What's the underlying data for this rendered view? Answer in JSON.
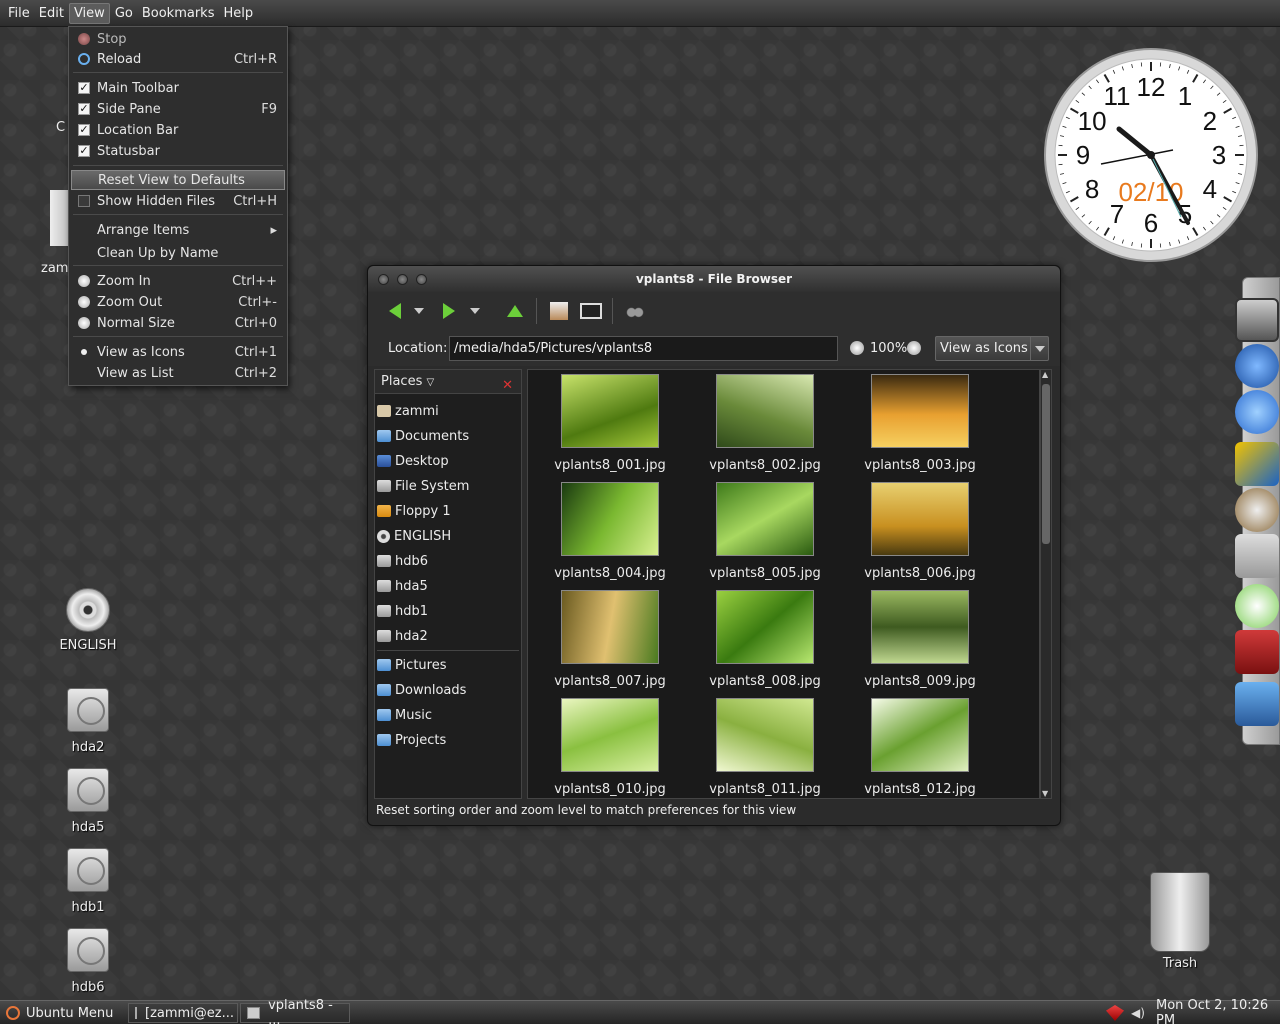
{
  "menubar": {
    "items": [
      "File",
      "Edit",
      "View",
      "Go",
      "Bookmarks",
      "Help"
    ]
  },
  "view_menu": {
    "items": [
      {
        "label": "Stop",
        "accel": "",
        "kind": "icon"
      },
      {
        "label": "Reload",
        "accel": "Ctrl+R",
        "kind": "icon"
      },
      {
        "label": "Main Toolbar",
        "accel": "",
        "kind": "check",
        "checked": true
      },
      {
        "label": "Side Pane",
        "accel": "F9",
        "kind": "check",
        "checked": true
      },
      {
        "label": "Location Bar",
        "accel": "",
        "kind": "check",
        "checked": true
      },
      {
        "label": "Statusbar",
        "accel": "",
        "kind": "check",
        "checked": true
      },
      {
        "label": "Reset View to Defaults",
        "accel": "",
        "kind": "plain",
        "highlighted": true
      },
      {
        "label": "Show Hidden Files",
        "accel": "Ctrl+H",
        "kind": "check",
        "checked": false
      },
      {
        "label": "Arrange Items",
        "accel": "▸",
        "kind": "plain"
      },
      {
        "label": "Clean Up by Name",
        "accel": "",
        "kind": "plain"
      },
      {
        "label": "Zoom In",
        "accel": "Ctrl++",
        "kind": "icon"
      },
      {
        "label": "Zoom Out",
        "accel": "Ctrl+-",
        "kind": "icon"
      },
      {
        "label": "Normal Size",
        "accel": "Ctrl+0",
        "kind": "icon"
      },
      {
        "label": "View as Icons",
        "accel": "Ctrl+1",
        "kind": "radio",
        "checked": true
      },
      {
        "label": "View as List",
        "accel": "Ctrl+2",
        "kind": "radio",
        "checked": false
      }
    ]
  },
  "desktop": {
    "icons": [
      {
        "label": "ENGLISH",
        "kind": "dvd"
      },
      {
        "label": "hda2",
        "kind": "drive"
      },
      {
        "label": "hda5",
        "kind": "drive"
      },
      {
        "label": "hdb1",
        "kind": "drive"
      },
      {
        "label": "hdb6",
        "kind": "drive"
      }
    ],
    "partial_labels": [
      "C",
      "zam"
    ],
    "trash_label": "Trash"
  },
  "clock": {
    "date_text": "02/10",
    "numerals": [
      "12",
      "1",
      "2",
      "3",
      "4",
      "5",
      "6",
      "7",
      "8",
      "9",
      "10",
      "11"
    ],
    "date_color": "#e87a1e"
  },
  "file_browser": {
    "title": "vplants8 - File Browser",
    "location_label": "Location:",
    "location_value": "/media/hda5/Pictures/vplants8",
    "zoom": "100%",
    "view_as": "View as Icons",
    "places_header": "Places",
    "places": [
      {
        "label": "zammi",
        "icon": "home"
      },
      {
        "label": "Documents",
        "icon": "folder"
      },
      {
        "label": "Desktop",
        "icon": "desk"
      },
      {
        "label": "File System",
        "icon": "drive"
      },
      {
        "label": "Floppy 1",
        "icon": "floppy"
      },
      {
        "label": "ENGLISH",
        "icon": "disc"
      },
      {
        "label": "hdb6",
        "icon": "drive"
      },
      {
        "label": "hda5",
        "icon": "drive"
      },
      {
        "label": "hdb1",
        "icon": "drive"
      },
      {
        "label": "hda2",
        "icon": "drive"
      },
      {
        "label": "Pictures",
        "icon": "folder"
      },
      {
        "label": "Downloads",
        "icon": "folder"
      },
      {
        "label": "Music",
        "icon": "folder"
      },
      {
        "label": "Projects",
        "icon": "folder"
      }
    ],
    "files": [
      "vplants8_001.jpg",
      "vplants8_002.jpg",
      "vplants8_003.jpg",
      "vplants8_004.jpg",
      "vplants8_005.jpg",
      "vplants8_006.jpg",
      "vplants8_007.jpg",
      "vplants8_008.jpg",
      "vplants8_009.jpg",
      "vplants8_010.jpg",
      "vplants8_011.jpg",
      "vplants8_012.jpg"
    ],
    "status": "Reset sorting order and zoom level to match preferences for this view"
  },
  "taskbar": {
    "menu_label": "Ubuntu Menu",
    "tasks": [
      "[zammi@ez...",
      "vplants8 - ..."
    ],
    "clock": "Mon Oct 2, 10:26 PM"
  },
  "colors": {
    "accent_green": "#6ccf3a",
    "close_red": "#dd3333"
  }
}
